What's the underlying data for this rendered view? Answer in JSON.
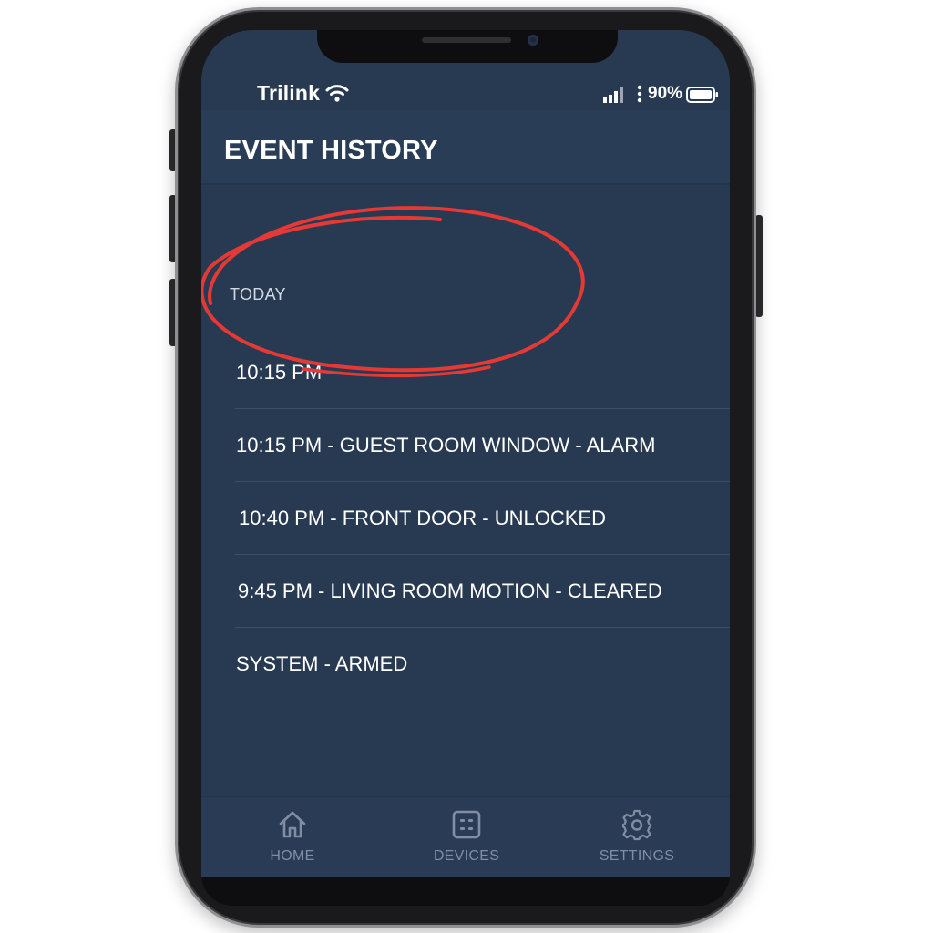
{
  "status_bar": {
    "carrier": "Trilink",
    "battery": "90%",
    "icons": [
      "wifi-icon",
      "signal-icon",
      "battery-icon"
    ]
  },
  "header": {
    "title": "EVENT HISTORY"
  },
  "section": {
    "label": "TODAY"
  },
  "events": [
    "10:15 PM",
    "10:15 PM - GUEST ROOM WINDOW - ALARM",
    "10:40 PM - FRONT DOOR - UNLOCKED",
    "9:45 PM - LIVING ROOM MOTION - CLEARED",
    "SYSTEM - ARMED"
  ],
  "tab_bar": {
    "items": [
      {
        "label": "HOME",
        "icon": "home-icon"
      },
      {
        "label": "DEVICES",
        "icon": "devices-icon"
      },
      {
        "label": "SETTINGS",
        "icon": "gear-icon"
      }
    ]
  },
  "colors": {
    "screen_background": "#283a52",
    "text": "#ffffff",
    "muted_tab": "#7f8ea3",
    "annotation": "#e53935"
  }
}
